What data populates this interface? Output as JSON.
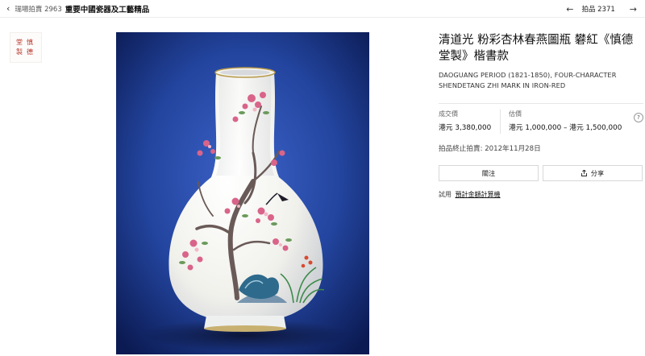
{
  "header": {
    "back_label": "瑞場拍賣 2963",
    "sale_title": "重要中國瓷器及工藝精品",
    "lot_label": "拍品 2371"
  },
  "thumbnail": {
    "seal_chars": [
      "堂",
      "慎",
      "製",
      "德"
    ]
  },
  "lot": {
    "title_zh": "清道光 粉彩杏林春燕圖瓶 礬紅《慎德堂製》楷書款",
    "title_en": "DAOGUANG PERIOD (1821-1850), FOUR-CHARACTER SHENDETANG ZHI MARK IN IRON-RED"
  },
  "prices": {
    "sold_label": "成交價",
    "sold_value": "港元 3,380,000",
    "estimate_label": "估價",
    "estimate_value": "港元 1,000,000 – 港元 1,500,000",
    "help_glyph": "?"
  },
  "closing": "拍品終止拍賣: 2012年11月28日",
  "actions": {
    "follow_label": "關注",
    "share_label": "分享"
  },
  "estimate_tool": {
    "prefix": "試用",
    "link_label": "預計金額計算機"
  },
  "colors": {
    "background_blue": "#1f3f9c",
    "vase_white": "#f6f6f2",
    "seal_red": "#b9362a",
    "blossom_pink": "#d9648a"
  },
  "icons": [
    "chevron-left-icon",
    "arrow-left-icon",
    "arrow-right-icon",
    "share-icon",
    "help-icon"
  ]
}
